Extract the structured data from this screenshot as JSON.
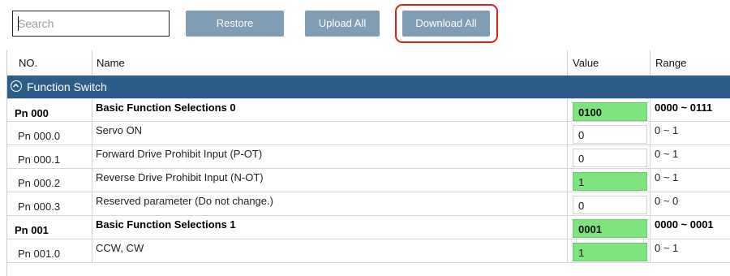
{
  "toolbar": {
    "search_placeholder": "Search",
    "restore_label": "Restore",
    "upload_label": "Upload All",
    "download_label": "Download All"
  },
  "table": {
    "headers": [
      "NO.",
      "Name",
      "Value",
      "Range"
    ],
    "group": {
      "label": "Function Switch",
      "icon": "collapse-up-icon"
    },
    "rows": [
      {
        "no": "Pn 000",
        "name": "Basic Function Selections 0",
        "value": "0100",
        "range": "0000 ~ 0111",
        "level": "major",
        "value_state": "changed"
      },
      {
        "no": "Pn 000.0",
        "name": "Servo ON",
        "value": "0",
        "range": "0 ~ 1",
        "level": "sub",
        "value_state": "default"
      },
      {
        "no": "Pn 000.1",
        "name": "Forward Drive Prohibit Input (P-OT)",
        "value": "0",
        "range": "0 ~ 1",
        "level": "sub",
        "value_state": "default"
      },
      {
        "no": "Pn 000.2",
        "name": "Reverse Drive Prohibit Input (N-OT)",
        "value": "1",
        "range": "0 ~ 1",
        "level": "sub",
        "value_state": "changed"
      },
      {
        "no": "Pn 000.3",
        "name": "Reserved parameter (Do not change.)",
        "value": "0",
        "range": "0 ~ 0",
        "level": "sub",
        "value_state": "default"
      },
      {
        "no": "Pn 001",
        "name": "Basic Function Selections 1",
        "value": "0001",
        "range": "0000 ~ 0001",
        "level": "major",
        "value_state": "changed"
      },
      {
        "no": "Pn 001.0",
        "name": "CCW, CW",
        "value": "1",
        "range": "0 ~ 1",
        "level": "sub",
        "value_state": "changed"
      }
    ]
  },
  "colors": {
    "button_bg": "#7f9db5",
    "group_bg": "#2f5d8a",
    "changed_value_bg": "#7ee57e",
    "highlight_border": "#e02020"
  }
}
